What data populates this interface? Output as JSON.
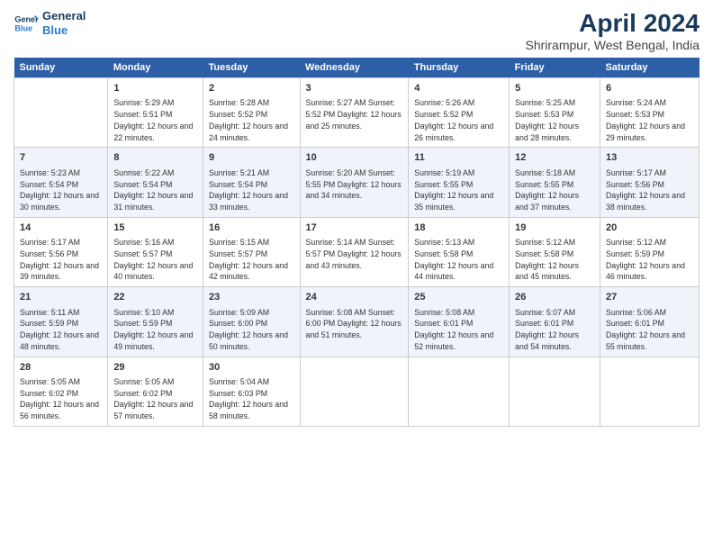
{
  "header": {
    "logo_line1": "General",
    "logo_line2": "Blue",
    "title": "April 2024",
    "subtitle": "Shrirampur, West Bengal, India"
  },
  "days_of_week": [
    "Sunday",
    "Monday",
    "Tuesday",
    "Wednesday",
    "Thursday",
    "Friday",
    "Saturday"
  ],
  "weeks": [
    [
      {
        "num": "",
        "info": ""
      },
      {
        "num": "1",
        "info": "Sunrise: 5:29 AM\nSunset: 5:51 PM\nDaylight: 12 hours\nand 22 minutes."
      },
      {
        "num": "2",
        "info": "Sunrise: 5:28 AM\nSunset: 5:52 PM\nDaylight: 12 hours\nand 24 minutes."
      },
      {
        "num": "3",
        "info": "Sunrise: 5:27 AM\nSunset: 5:52 PM\nDaylight: 12 hours\nand 25 minutes."
      },
      {
        "num": "4",
        "info": "Sunrise: 5:26 AM\nSunset: 5:52 PM\nDaylight: 12 hours\nand 26 minutes."
      },
      {
        "num": "5",
        "info": "Sunrise: 5:25 AM\nSunset: 5:53 PM\nDaylight: 12 hours\nand 28 minutes."
      },
      {
        "num": "6",
        "info": "Sunrise: 5:24 AM\nSunset: 5:53 PM\nDaylight: 12 hours\nand 29 minutes."
      }
    ],
    [
      {
        "num": "7",
        "info": "Sunrise: 5:23 AM\nSunset: 5:54 PM\nDaylight: 12 hours\nand 30 minutes."
      },
      {
        "num": "8",
        "info": "Sunrise: 5:22 AM\nSunset: 5:54 PM\nDaylight: 12 hours\nand 31 minutes."
      },
      {
        "num": "9",
        "info": "Sunrise: 5:21 AM\nSunset: 5:54 PM\nDaylight: 12 hours\nand 33 minutes."
      },
      {
        "num": "10",
        "info": "Sunrise: 5:20 AM\nSunset: 5:55 PM\nDaylight: 12 hours\nand 34 minutes."
      },
      {
        "num": "11",
        "info": "Sunrise: 5:19 AM\nSunset: 5:55 PM\nDaylight: 12 hours\nand 35 minutes."
      },
      {
        "num": "12",
        "info": "Sunrise: 5:18 AM\nSunset: 5:55 PM\nDaylight: 12 hours\nand 37 minutes."
      },
      {
        "num": "13",
        "info": "Sunrise: 5:17 AM\nSunset: 5:56 PM\nDaylight: 12 hours\nand 38 minutes."
      }
    ],
    [
      {
        "num": "14",
        "info": "Sunrise: 5:17 AM\nSunset: 5:56 PM\nDaylight: 12 hours\nand 39 minutes."
      },
      {
        "num": "15",
        "info": "Sunrise: 5:16 AM\nSunset: 5:57 PM\nDaylight: 12 hours\nand 40 minutes."
      },
      {
        "num": "16",
        "info": "Sunrise: 5:15 AM\nSunset: 5:57 PM\nDaylight: 12 hours\nand 42 minutes."
      },
      {
        "num": "17",
        "info": "Sunrise: 5:14 AM\nSunset: 5:57 PM\nDaylight: 12 hours\nand 43 minutes."
      },
      {
        "num": "18",
        "info": "Sunrise: 5:13 AM\nSunset: 5:58 PM\nDaylight: 12 hours\nand 44 minutes."
      },
      {
        "num": "19",
        "info": "Sunrise: 5:12 AM\nSunset: 5:58 PM\nDaylight: 12 hours\nand 45 minutes."
      },
      {
        "num": "20",
        "info": "Sunrise: 5:12 AM\nSunset: 5:59 PM\nDaylight: 12 hours\nand 46 minutes."
      }
    ],
    [
      {
        "num": "21",
        "info": "Sunrise: 5:11 AM\nSunset: 5:59 PM\nDaylight: 12 hours\nand 48 minutes."
      },
      {
        "num": "22",
        "info": "Sunrise: 5:10 AM\nSunset: 5:59 PM\nDaylight: 12 hours\nand 49 minutes."
      },
      {
        "num": "23",
        "info": "Sunrise: 5:09 AM\nSunset: 6:00 PM\nDaylight: 12 hours\nand 50 minutes."
      },
      {
        "num": "24",
        "info": "Sunrise: 5:08 AM\nSunset: 6:00 PM\nDaylight: 12 hours\nand 51 minutes."
      },
      {
        "num": "25",
        "info": "Sunrise: 5:08 AM\nSunset: 6:01 PM\nDaylight: 12 hours\nand 52 minutes."
      },
      {
        "num": "26",
        "info": "Sunrise: 5:07 AM\nSunset: 6:01 PM\nDaylight: 12 hours\nand 54 minutes."
      },
      {
        "num": "27",
        "info": "Sunrise: 5:06 AM\nSunset: 6:01 PM\nDaylight: 12 hours\nand 55 minutes."
      }
    ],
    [
      {
        "num": "28",
        "info": "Sunrise: 5:05 AM\nSunset: 6:02 PM\nDaylight: 12 hours\nand 56 minutes."
      },
      {
        "num": "29",
        "info": "Sunrise: 5:05 AM\nSunset: 6:02 PM\nDaylight: 12 hours\nand 57 minutes."
      },
      {
        "num": "30",
        "info": "Sunrise: 5:04 AM\nSunset: 6:03 PM\nDaylight: 12 hours\nand 58 minutes."
      },
      {
        "num": "",
        "info": ""
      },
      {
        "num": "",
        "info": ""
      },
      {
        "num": "",
        "info": ""
      },
      {
        "num": "",
        "info": ""
      }
    ]
  ]
}
